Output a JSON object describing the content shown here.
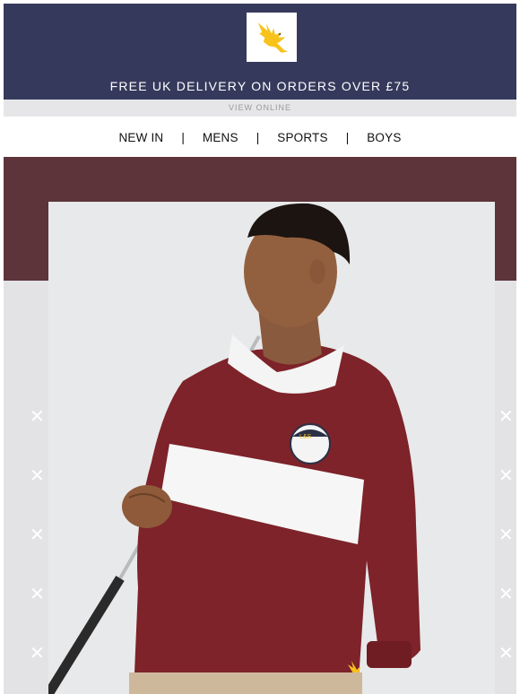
{
  "brand": {
    "logo_icon": "golden-eagle-icon",
    "logo_color": "#f7c31b"
  },
  "header": {
    "background": "#353a5c",
    "delivery_text": "FREE UK DELIVERY ON ORDERS OVER £75"
  },
  "view_online": {
    "label": "VIEW ONLINE"
  },
  "nav": {
    "items": [
      {
        "label": "NEW IN"
      },
      {
        "label": "MENS"
      },
      {
        "label": "SPORTS"
      },
      {
        "label": "BOYS"
      }
    ],
    "separator": "|"
  },
  "hero": {
    "band_color": "#5c343a",
    "pattern_icon": "cross-icon",
    "model_image": "model-in-rugby-shirt-with-golf-club",
    "patch_text": "L&S"
  }
}
